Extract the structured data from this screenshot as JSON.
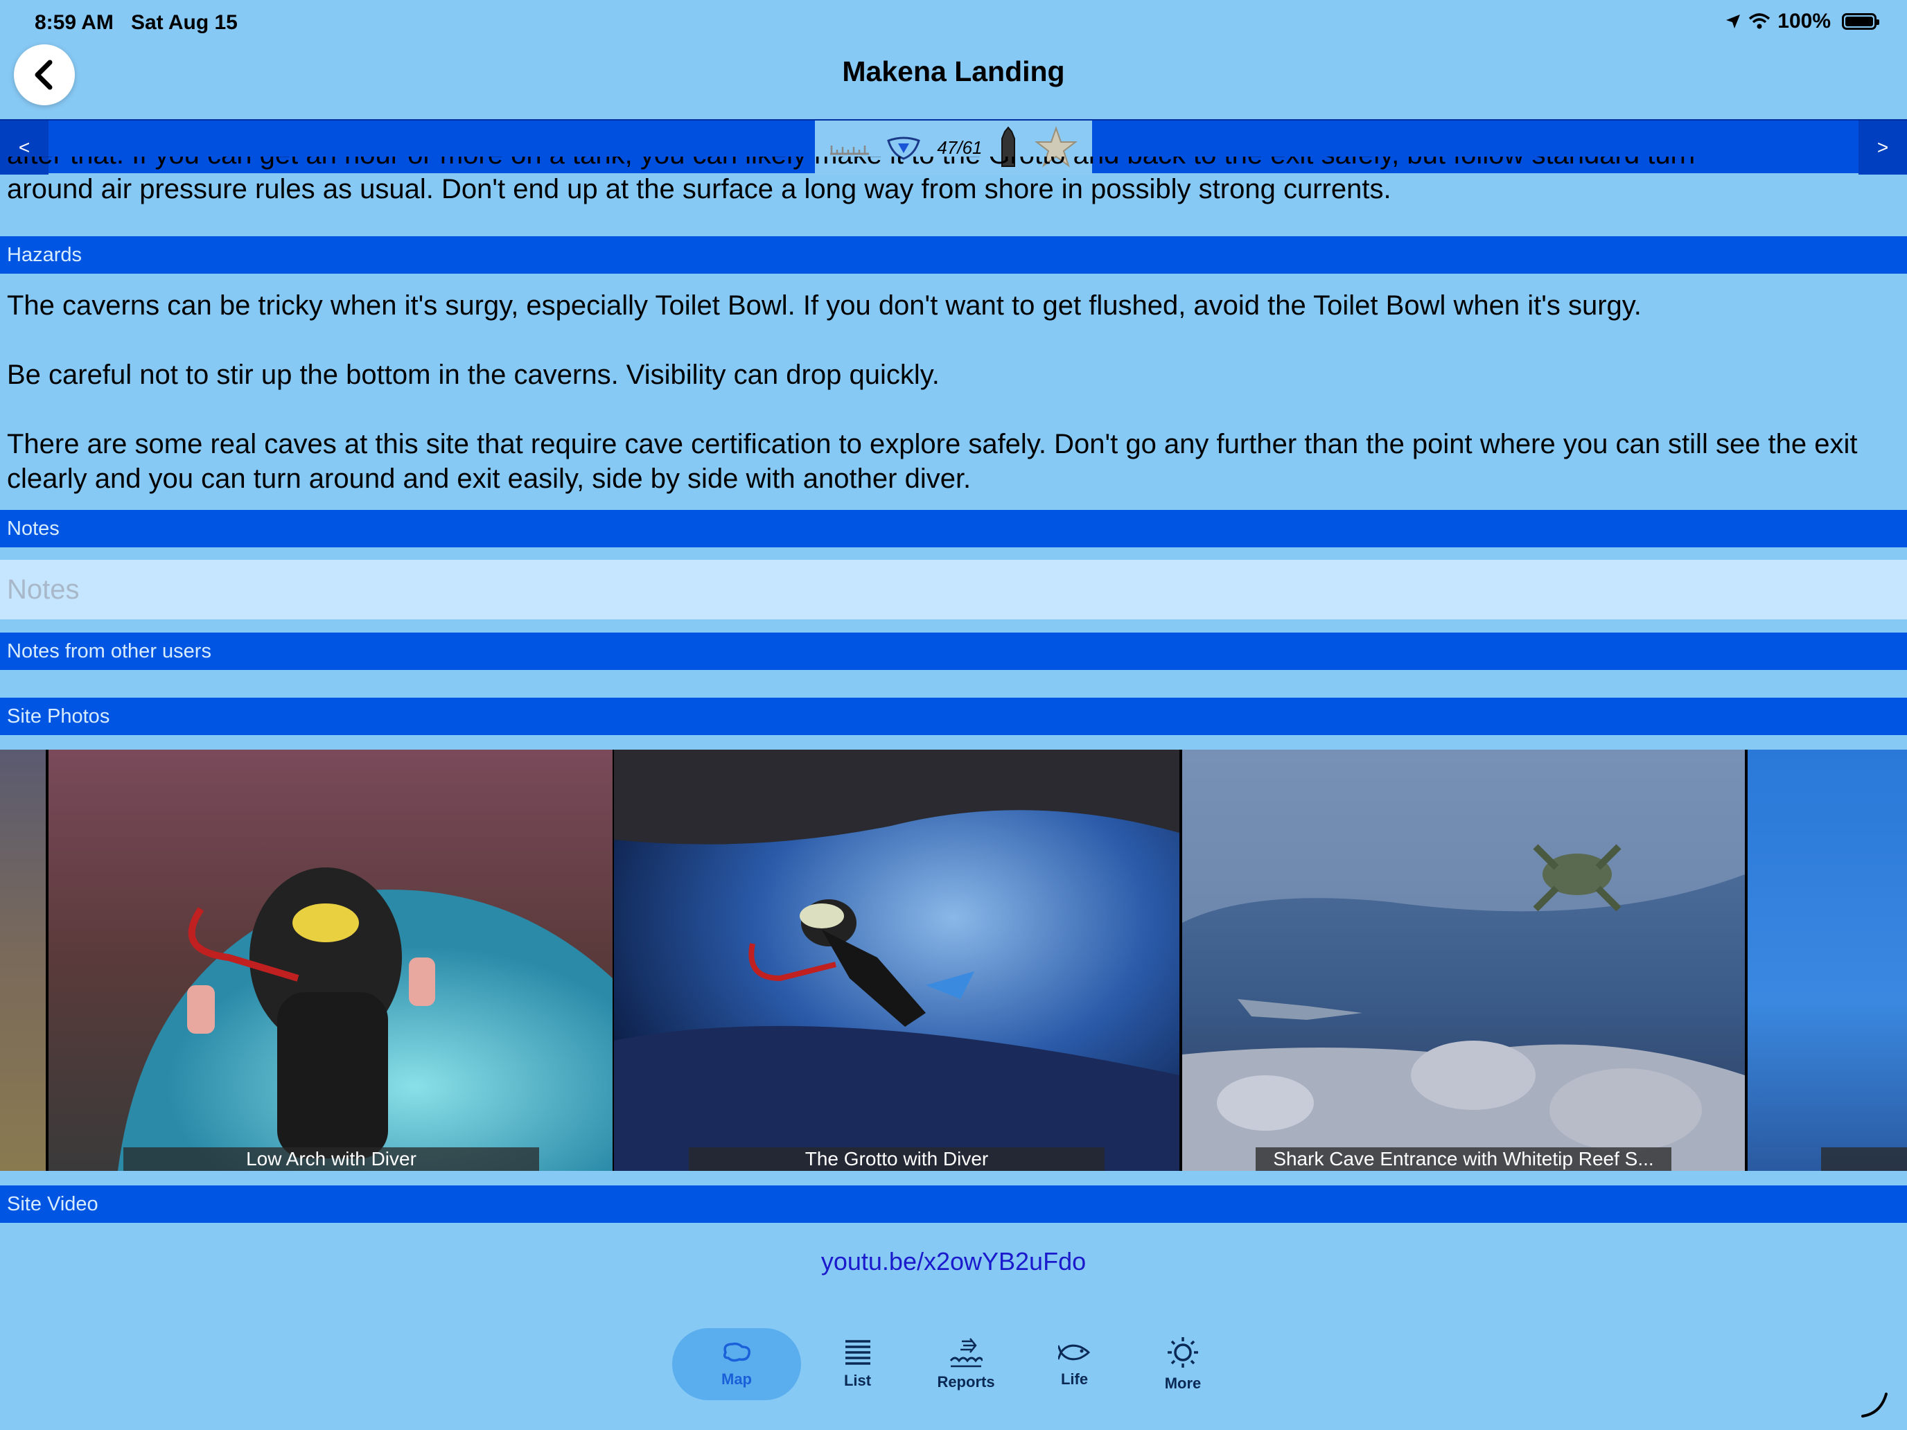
{
  "status": {
    "time": "8:59 AM",
    "date": "Sat Aug 15",
    "battery": "100%"
  },
  "header": {
    "title": "Makena Landing"
  },
  "toolbar": {
    "prev_label": "<",
    "next_label": ">",
    "counter": "47/61"
  },
  "content": {
    "clipped_line_1": "after that. If you can get an hour or more on a tank, you can likely make it to the Grotto and back to the exit safely, but follow standard turn",
    "clipped_line_2": "around air pressure rules as usual. Don't end up at the surface a long way from shore in possibly strong currents.",
    "hazards_header": "Hazards",
    "hazards_p1": "The caverns can be tricky when it's surgy, especially Toilet Bowl. If you don't want to get flushed, avoid the Toilet Bowl when it's surgy.",
    "hazards_p2": "Be careful not to stir up the bottom in the caverns. Visibility can drop quickly.",
    "hazards_p3": "There are some real caves at this site that require cave certification to explore safely. Don't go any further than the point where you can still see the exit clearly and you can turn around and exit easily, side by side with another diver.",
    "notes_header": "Notes",
    "notes_placeholder": "Notes",
    "other_notes_header": "Notes from other users",
    "photos_header": "Site Photos",
    "photos": [
      {
        "caption": "Low Arch with Diver"
      },
      {
        "caption": "The Grotto with Diver"
      },
      {
        "caption": "Shark Cave Entrance with Whitetip Reef S..."
      }
    ],
    "video_header": "Site Video",
    "video_link": "youtu.be/x2owYB2uFdo"
  },
  "tabs": [
    {
      "label": "Map",
      "icon": "map-icon",
      "active": true
    },
    {
      "label": "List",
      "icon": "list-icon"
    },
    {
      "label": "Reports",
      "icon": "reports-icon"
    },
    {
      "label": "Life",
      "icon": "fish-icon"
    },
    {
      "label": "More",
      "icon": "sun-icon"
    }
  ],
  "colors": {
    "background": "#87c9f5",
    "section_header": "#0055e2",
    "toolbar": "#0050e0",
    "link": "#1a1acc"
  }
}
